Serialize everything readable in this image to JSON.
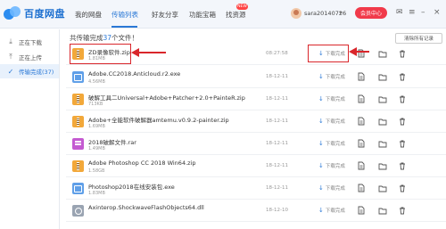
{
  "app": {
    "name": "百度网盘"
  },
  "nav": {
    "tabs": [
      {
        "label": "我的网盘"
      },
      {
        "label": "传输列表"
      },
      {
        "label": "好友分享"
      },
      {
        "label": "功能宝箱"
      },
      {
        "label": "找资源"
      }
    ],
    "active_tab": "传输列表",
    "new_badge": "NEW"
  },
  "user": {
    "name": "sara20140726",
    "member_button": "会员中心"
  },
  "sidebar": {
    "items": [
      {
        "label": "正在下载"
      },
      {
        "label": "正在上传"
      },
      {
        "label": "传输完成(37)"
      }
    ],
    "active": "传输完成(37)"
  },
  "summary": {
    "prefix": "共传输完成",
    "count": "37",
    "suffix": "个文件！"
  },
  "clear_button": "清除所有记录",
  "files": [
    {
      "name": "ZD录像软件.zip",
      "size": "1.81MB",
      "date": "08:27:58",
      "status": "下载完成",
      "type": "zip"
    },
    {
      "name": "Adobe.CC2018.Anticloud.r2.exe",
      "size": "4.56MB",
      "date": "18-12-11",
      "status": "下载完成",
      "type": "exe"
    },
    {
      "name": "破解工具二Universal+Adobe+Patcher+2.0+PainteR.zip",
      "size": "713KB",
      "date": "18-12-11",
      "status": "下载完成",
      "type": "zip"
    },
    {
      "name": "Adobe+全能软件破解器amtemu.v0.9.2-painter.zip",
      "size": "1.69MB",
      "date": "18-12-11",
      "status": "下载完成",
      "type": "zip"
    },
    {
      "name": "2018破解文件.rar",
      "size": "1.49MB",
      "date": "18-12-11",
      "status": "下载完成",
      "type": "rar"
    },
    {
      "name": "Adobe Photoshop CC 2018 Win64.zip",
      "size": "1.58GB",
      "date": "18-12-11",
      "status": "下载完成",
      "type": "zip"
    },
    {
      "name": "Photoshop2018在线安装包.exe",
      "size": "1.83MB",
      "date": "18-12-11",
      "status": "下载完成",
      "type": "exe"
    },
    {
      "name": "Axinterop.ShockwaveFlashObjects64.dll",
      "size": "",
      "date": "18-12-10",
      "status": "下载完成",
      "type": "dll"
    }
  ],
  "colors": {
    "accent": "#2a78d6",
    "annotation": "#d9262b",
    "member": "#f13a4a"
  }
}
